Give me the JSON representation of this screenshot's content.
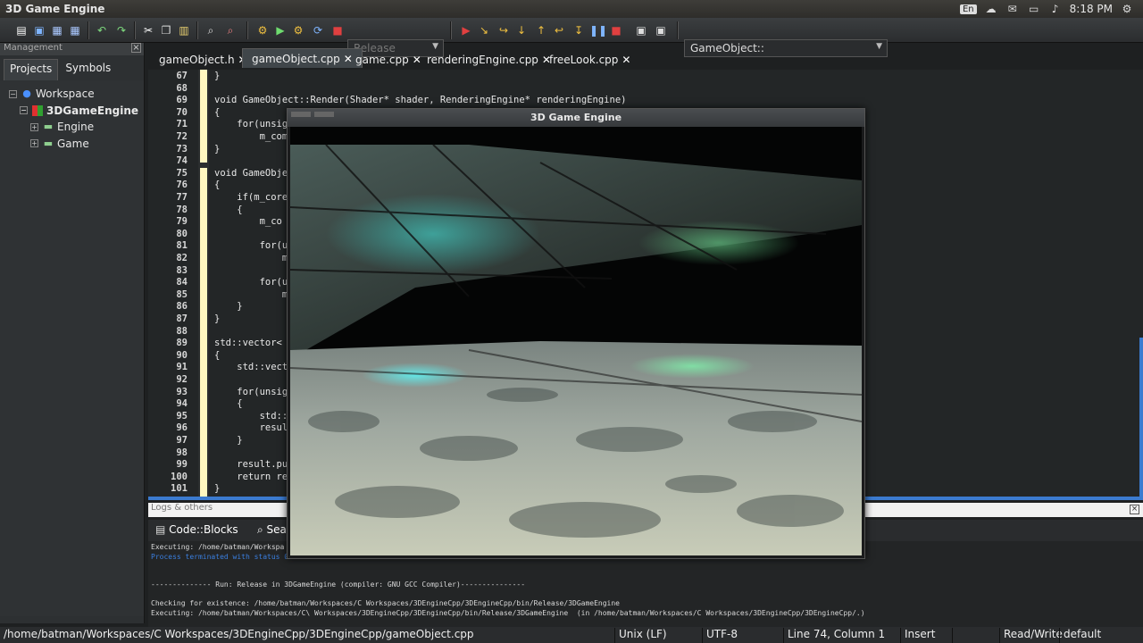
{
  "window": {
    "title": "3D Game Engine"
  },
  "tray": {
    "lang": "En",
    "time": "8:18 PM"
  },
  "toolbar": {
    "build_target": "Release",
    "scope": "GameObject::"
  },
  "management": {
    "title": "Management",
    "tabs": [
      "Projects",
      "Symbols"
    ],
    "tree": [
      {
        "label": "Workspace",
        "icon": "workspace-icon"
      },
      {
        "label": "3DGameEngine",
        "icon": "project-icon"
      },
      {
        "label": "Engine",
        "icon": "folder-icon"
      },
      {
        "label": "Game",
        "icon": "folder-icon"
      }
    ]
  },
  "editor_tabs": [
    "gameObject.h",
    "gameObject.cpp",
    "game.cpp",
    "renderingEngine.cpp",
    "freeLook.cpp"
  ],
  "code_lines": [
    {
      "n": "67",
      "t": "}"
    },
    {
      "n": "68",
      "t": ""
    },
    {
      "n": "69",
      "t": "void GameObject::Render(Shader* shader, RenderingEngine* renderingEngine)"
    },
    {
      "n": "70",
      "t": "{"
    },
    {
      "n": "71",
      "t": "    for(unsig"
    },
    {
      "n": "72",
      "t": "        m_com"
    },
    {
      "n": "73",
      "t": "}"
    },
    {
      "n": "74",
      "t": ""
    },
    {
      "n": "75",
      "t": "void GameObje"
    },
    {
      "n": "76",
      "t": "{"
    },
    {
      "n": "77",
      "t": "    if(m_core"
    },
    {
      "n": "78",
      "t": "    {"
    },
    {
      "n": "79",
      "t": "        m_co"
    },
    {
      "n": "80",
      "t": ""
    },
    {
      "n": "81",
      "t": "        for(u"
    },
    {
      "n": "82",
      "t": "            m"
    },
    {
      "n": "83",
      "t": ""
    },
    {
      "n": "84",
      "t": "        for(u"
    },
    {
      "n": "85",
      "t": "            m"
    },
    {
      "n": "86",
      "t": "    }"
    },
    {
      "n": "87",
      "t": "}"
    },
    {
      "n": "88",
      "t": ""
    },
    {
      "n": "89",
      "t": "std::vector<"
    },
    {
      "n": "90",
      "t": "{"
    },
    {
      "n": "91",
      "t": "    std::vect"
    },
    {
      "n": "92",
      "t": ""
    },
    {
      "n": "93",
      "t": "    for(unsig"
    },
    {
      "n": "94",
      "t": "    {"
    },
    {
      "n": "95",
      "t": "        std::"
    },
    {
      "n": "96",
      "t": "        resul"
    },
    {
      "n": "97",
      "t": "    }"
    },
    {
      "n": "98",
      "t": ""
    },
    {
      "n": "99",
      "t": "    result.pu"
    },
    {
      "n": "100",
      "t": "    return re"
    },
    {
      "n": "101",
      "t": "}"
    }
  ],
  "logs": {
    "title": "Logs & others",
    "tabs": [
      "Code::Blocks",
      "Sea"
    ],
    "lines": [
      {
        "t": "Executing: /home/batman/Workspa",
        "blue": false
      },
      {
        "t": "Process terminated with status 0",
        "blue": true
      },
      {
        "t": "",
        "blue": false
      },
      {
        "t": "",
        "blue": false
      },
      {
        "t": "-------------- Run: Release in 3DGameEngine (compiler: GNU GCC Compiler)---------------",
        "blue": false
      },
      {
        "t": "",
        "blue": false
      },
      {
        "t": "Checking for existence: /home/batman/Workspaces/C Workspaces/3DEngineCpp/3DEngineCpp/bin/Release/3DGameEngine",
        "blue": false
      },
      {
        "t": "Executing: /home/batman/Workspaces/C\\ Workspaces/3DEngineCpp/3DEngineCpp/bin/Release/3DGameEngine  (in /home/batman/Workspaces/C Workspaces/3DEngineCpp/3DEngineCpp/.)",
        "blue": false
      }
    ]
  },
  "status": {
    "path": "/home/batman/Workspaces/C Workspaces/3DEngineCpp/3DEngineCpp/gameObject.cpp",
    "eol": "Unix (LF)",
    "encoding": "UTF-8",
    "position": "Line 74, Column 1",
    "mode": "Insert",
    "access": "Read/Write",
    "lang": "default"
  },
  "game_window": {
    "title": "3D Game Engine"
  }
}
